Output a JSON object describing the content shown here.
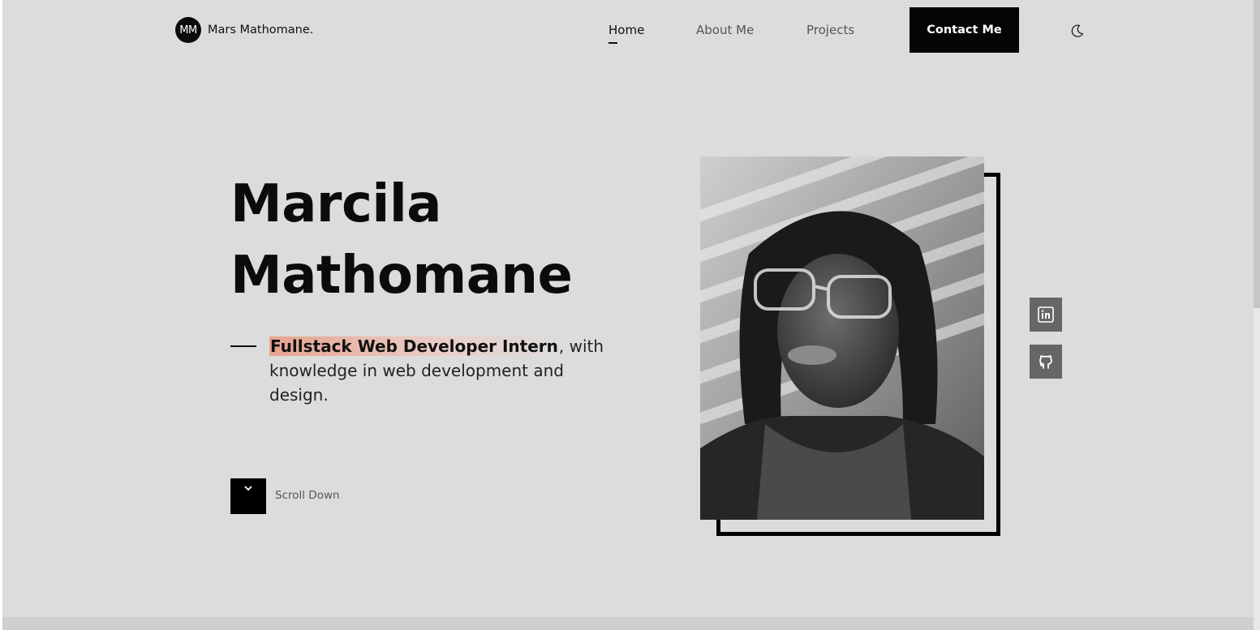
{
  "header": {
    "logo_initials": "MM",
    "logo_name": "Mars Mathomane.",
    "nav": [
      {
        "label": "Home",
        "active": true
      },
      {
        "label": "About Me",
        "active": false
      },
      {
        "label": "Projects",
        "active": false
      }
    ],
    "contact_label": "Contact Me",
    "theme_icon": "moon-icon"
  },
  "hero": {
    "first_name": "Marcila",
    "last_name": "Mathomane",
    "role": "Fullstack Web Developer Intern",
    "role_suffix": ",",
    "tagline_rest": "with knowledge in web development and design.",
    "scroll_label": "Scroll Down",
    "scroll_icon": "chevron-down-icon"
  },
  "social": [
    {
      "icon": "linkedin-icon"
    },
    {
      "icon": "github-icon"
    }
  ],
  "colors": {
    "background": "#dcdcdc",
    "accent_dark": "#050505",
    "role_highlight": "#e8a08c",
    "social_bg": "#666666"
  }
}
